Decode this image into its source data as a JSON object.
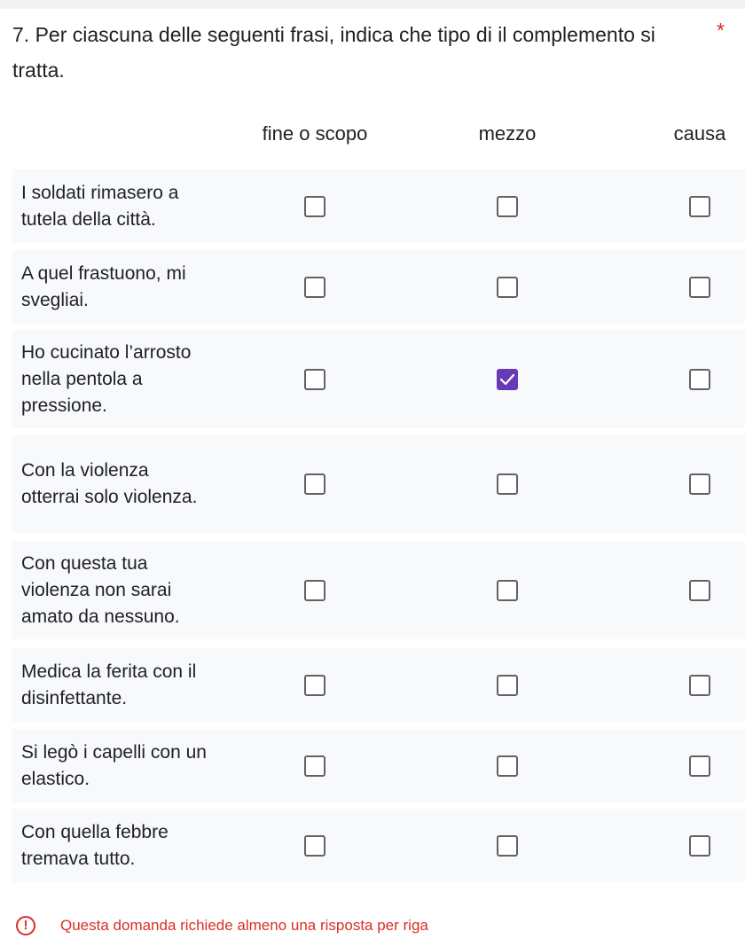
{
  "question": {
    "title": "7. Per ciascuna delle seguenti frasi, indica che tipo di  il complemento si tratta.",
    "required_marker": "*"
  },
  "columns": [
    "fine o scopo",
    "mezzo",
    "causa"
  ],
  "rows": [
    {
      "label": "I soldati rimasero a tutela della città.",
      "checked": [
        false,
        false,
        false
      ]
    },
    {
      "label": "A quel frastuono, mi svegliai.",
      "checked": [
        false,
        false,
        false
      ]
    },
    {
      "label": "Ho cucinato l’arrosto nella pentola a pressione.",
      "checked": [
        false,
        true,
        false
      ]
    },
    {
      "label": "Con la violenza otterrai solo violenza.",
      "checked": [
        false,
        false,
        false
      ]
    },
    {
      "label": "Con questa tua violenza non sarai amato da nessuno.",
      "checked": [
        false,
        false,
        false
      ]
    },
    {
      "label": "Medica la ferita con il disinfettante.",
      "checked": [
        false,
        false,
        false
      ]
    },
    {
      "label": "Si legò i capelli con un elastico.",
      "checked": [
        false,
        false,
        false
      ]
    },
    {
      "label": "Con quella febbre tremava tutto.",
      "checked": [
        false,
        false,
        false
      ]
    }
  ],
  "validation": {
    "icon": "exclamation-circle-icon",
    "message": "Questa domanda richiede almeno una risposta per riga"
  },
  "colors": {
    "accent": "#673ab7",
    "error": "#d93025",
    "row_background": "#f8f9fa"
  }
}
